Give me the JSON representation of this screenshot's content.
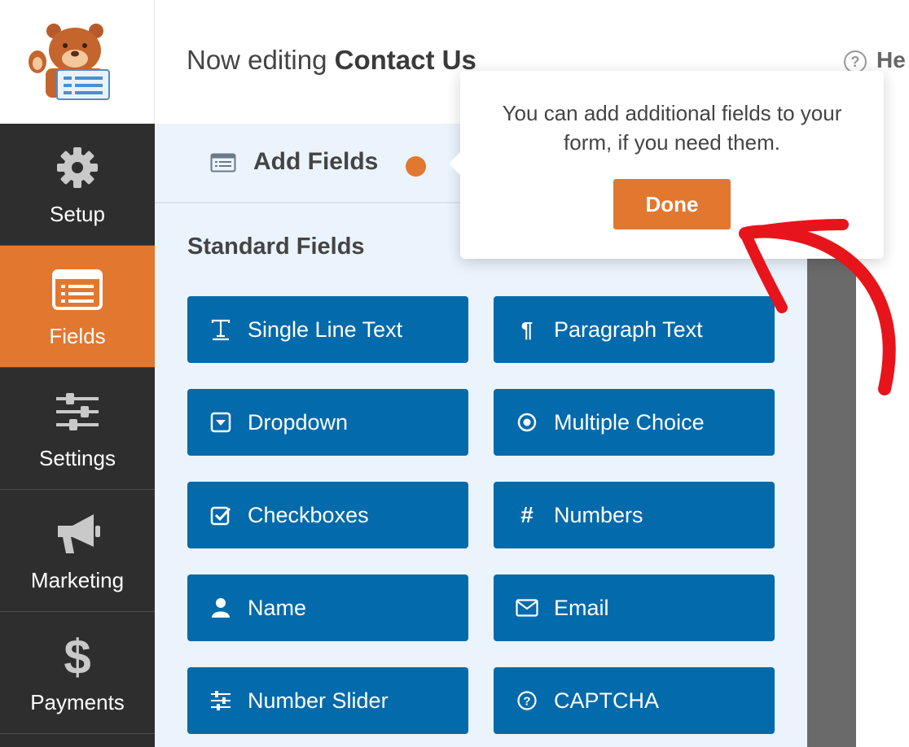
{
  "header": {
    "editing_prefix": "Now editing",
    "form_name": "Contact Us",
    "help_label": "He"
  },
  "sidebar": {
    "items": [
      {
        "label": "Setup",
        "icon": "gear-icon"
      },
      {
        "label": "Fields",
        "icon": "fields-list-icon",
        "active": true
      },
      {
        "label": "Settings",
        "icon": "sliders-icon"
      },
      {
        "label": "Marketing",
        "icon": "megaphone-icon"
      },
      {
        "label": "Payments",
        "icon": "dollar-icon"
      }
    ]
  },
  "panel": {
    "tab_label": "Add Fields",
    "section_title": "Standard Fields",
    "fields": [
      {
        "label": "Single Line Text",
        "icon": "text-icon"
      },
      {
        "label": "Paragraph Text",
        "icon": "paragraph-icon"
      },
      {
        "label": "Dropdown",
        "icon": "dropdown-icon"
      },
      {
        "label": "Multiple Choice",
        "icon": "radio-icon"
      },
      {
        "label": "Checkboxes",
        "icon": "checkbox-icon"
      },
      {
        "label": "Numbers",
        "icon": "hash-icon"
      },
      {
        "label": "Name",
        "icon": "user-icon"
      },
      {
        "label": "Email",
        "icon": "envelope-icon"
      },
      {
        "label": "Number Slider",
        "icon": "slider-icon"
      },
      {
        "label": "CAPTCHA",
        "icon": "question-circle-icon"
      }
    ]
  },
  "tooltip": {
    "text": "You can add additional fields to your form, if you need them.",
    "done_label": "Done"
  },
  "colors": {
    "accent": "#e27730",
    "field_button": "#036aab",
    "sidebar": "#2e2e2e",
    "panel": "#ebf3fc",
    "annotation_arrow": "#e8141b"
  }
}
